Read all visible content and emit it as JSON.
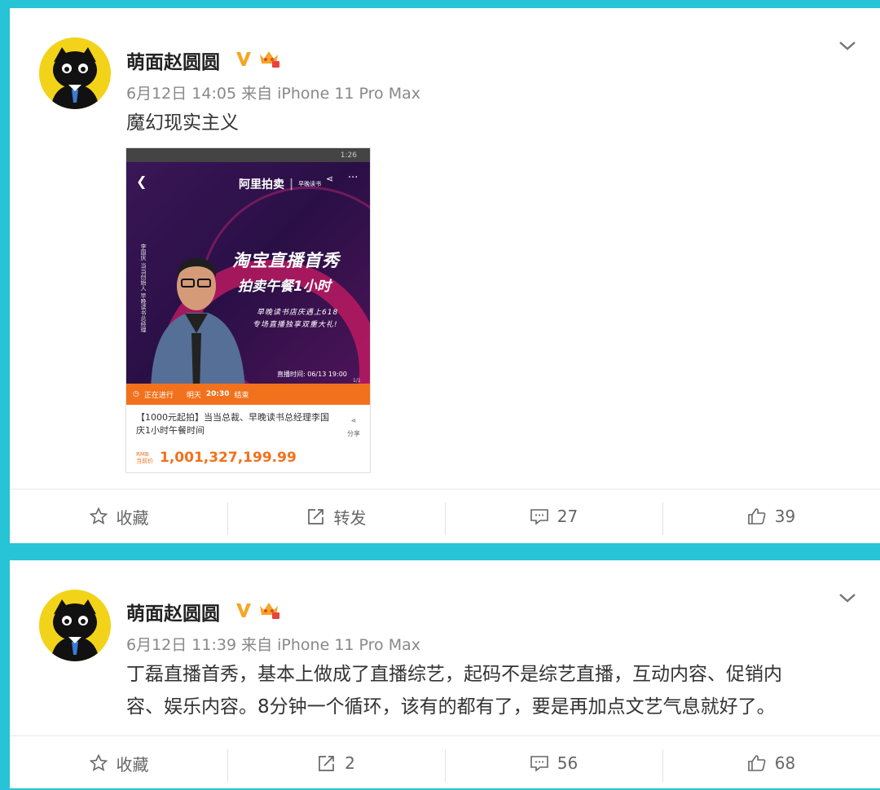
{
  "posts": [
    {
      "author": "萌面赵圆圆",
      "meta": "6月12日 14:05 来自 iPhone 11 Pro Max",
      "text": "魔幻现实主义",
      "image": {
        "logo_left": "阿里拍卖",
        "logo_right": "早晚读书",
        "headline1": "淘宝直播首秀",
        "headline2": "拍卖午餐1小时",
        "sub1": "早晚读书店庆遇上618",
        "sub2": "专场直播独享双重大礼!",
        "vertical": "李国庆 当当创始人 早晚读书总经理",
        "live_time": "直播时间: 06/13 19:00",
        "pager": "1/1",
        "status_time": "1:26",
        "bar_status": "正在进行",
        "bar_end_prefix": "明天",
        "bar_end_time": "20:30",
        "bar_end_suffix": "结束",
        "desc": "【1000元起拍】当当总裁、早晚读书总经理李国庆1小时午餐时间",
        "share": "分享",
        "rmb": "RMB",
        "current_price_label": "当前价",
        "price": "1,001,327,199.99"
      },
      "actions": {
        "fav": "收藏",
        "repost": "转发",
        "comments": "27",
        "likes": "39"
      }
    },
    {
      "author": "萌面赵圆圆",
      "meta": "6月12日 11:39 来自 iPhone 11 Pro Max",
      "text_line1": "丁磊直播首秀，基本上做成了直播综艺，起码不是综艺直播，互动内容、促销内",
      "text_line2": "容、娱乐内容。8分钟一个循环，该有的都有了，要是再加点文艺气息就好了。",
      "actions": {
        "fav": "收藏",
        "repost": "2",
        "comments": "56",
        "likes": "68"
      }
    }
  ],
  "colors": {
    "background": "#27c3d6",
    "verified": "#f5a623",
    "accent": "#f2711c"
  }
}
